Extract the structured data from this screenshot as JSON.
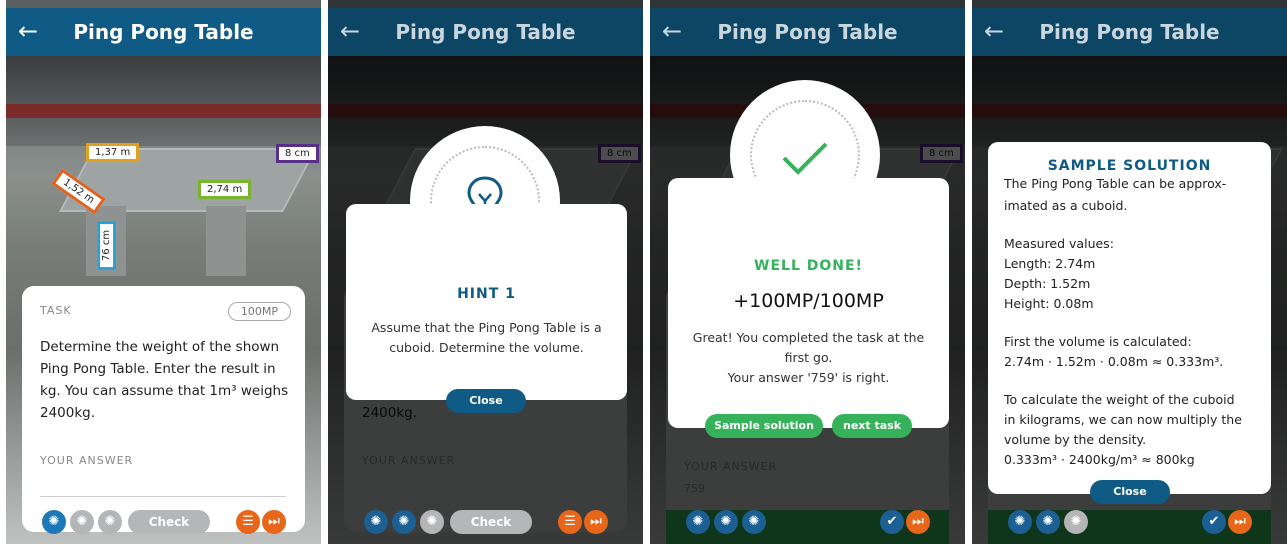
{
  "header": {
    "back_glyph": "←",
    "title": "Ping Pong Table"
  },
  "measurements": {
    "width": "1,37 m",
    "height_net": "8 cm",
    "depth": "1,52 m",
    "length": "2,74 m",
    "leg": "76 cm"
  },
  "task_card": {
    "label": "TASK",
    "points": "100MP",
    "text": "Determine the weight of the shown Ping Pong Table. Enter the result in kg. You can assume that 1m³ weighs 2400kg.",
    "text_tail": "2400kg.",
    "answer_label": "YOUR ANSWER",
    "answer_value": "759",
    "check_label": "Check"
  },
  "hint_modal": {
    "title": "HINT 1",
    "text": "Assume that the Ping Pong Table is a cuboid. Determine the volume.",
    "close": "Close"
  },
  "result_modal": {
    "title": "WELL DONE!",
    "score": "+100MP/100MP",
    "line1": "Great! You completed the task at the",
    "line2": "first go.",
    "line3": "Your answer '759' is right.",
    "sample_button": "Sample solution",
    "next_button": "next task"
  },
  "solution_modal": {
    "title": "SAMPLE SOLUTION",
    "lines": [
      "The Ping Pong Table can be approx-",
      "imated as a cuboid.",
      "Measured values:",
      "Length: 2.74m",
      "Depth: 1.52m",
      "Height: 0.08m",
      "First the volume is calculated:",
      "2.74m · 1.52m · 0.08m ≈ 0.333m³.",
      "To calculate the weight of the cuboid",
      "in kilograms, we can now multiply the",
      "volume by the density.",
      "0.333m³ · 2400kg/m³ ≈ 800kg"
    ],
    "close": "Close"
  },
  "icons": {
    "hint": "lightbulb-icon",
    "list": "list-icon",
    "skip": "skip-icon",
    "check": "checkmark-icon"
  },
  "colors": {
    "navy": "#0f5b86",
    "green": "#35b25a",
    "orange": "#e8661a"
  }
}
